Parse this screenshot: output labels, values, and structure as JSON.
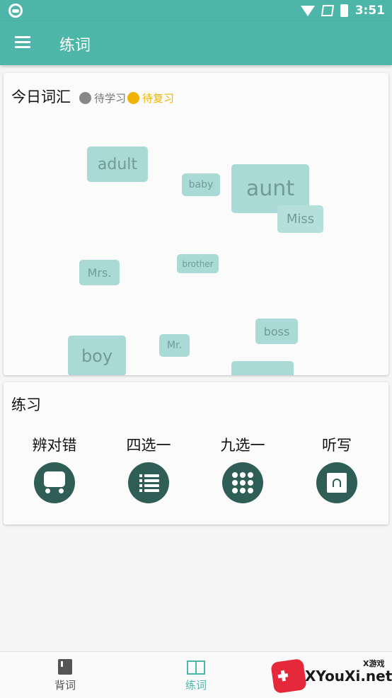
{
  "status_bar": {
    "time": "3:51"
  },
  "app_bar": {
    "title": "练词"
  },
  "vocab_card": {
    "heading": "今日词汇",
    "legend": [
      {
        "label": "待学习",
        "color": "#888888"
      },
      {
        "label": "待复习",
        "color": "#f0b400"
      }
    ],
    "words": [
      "adult",
      "baby",
      "aunt",
      "Miss",
      "Mrs.",
      "brother",
      "boss",
      "boy",
      "Mr."
    ]
  },
  "practice_card": {
    "heading": "练习",
    "items": [
      {
        "label": "辨对错",
        "icon": "card-check-icon"
      },
      {
        "label": "四选一",
        "icon": "list-icon"
      },
      {
        "label": "九选一",
        "icon": "grid-icon"
      },
      {
        "label": "听写",
        "icon": "headphones-icon"
      }
    ]
  },
  "bottom_nav": {
    "items": [
      {
        "label": "背词",
        "active": false
      },
      {
        "label": "练词",
        "active": true
      }
    ],
    "active_color": "#4db6a8"
  },
  "watermark": {
    "text": "XYouXi.net",
    "small": "X游戏"
  }
}
